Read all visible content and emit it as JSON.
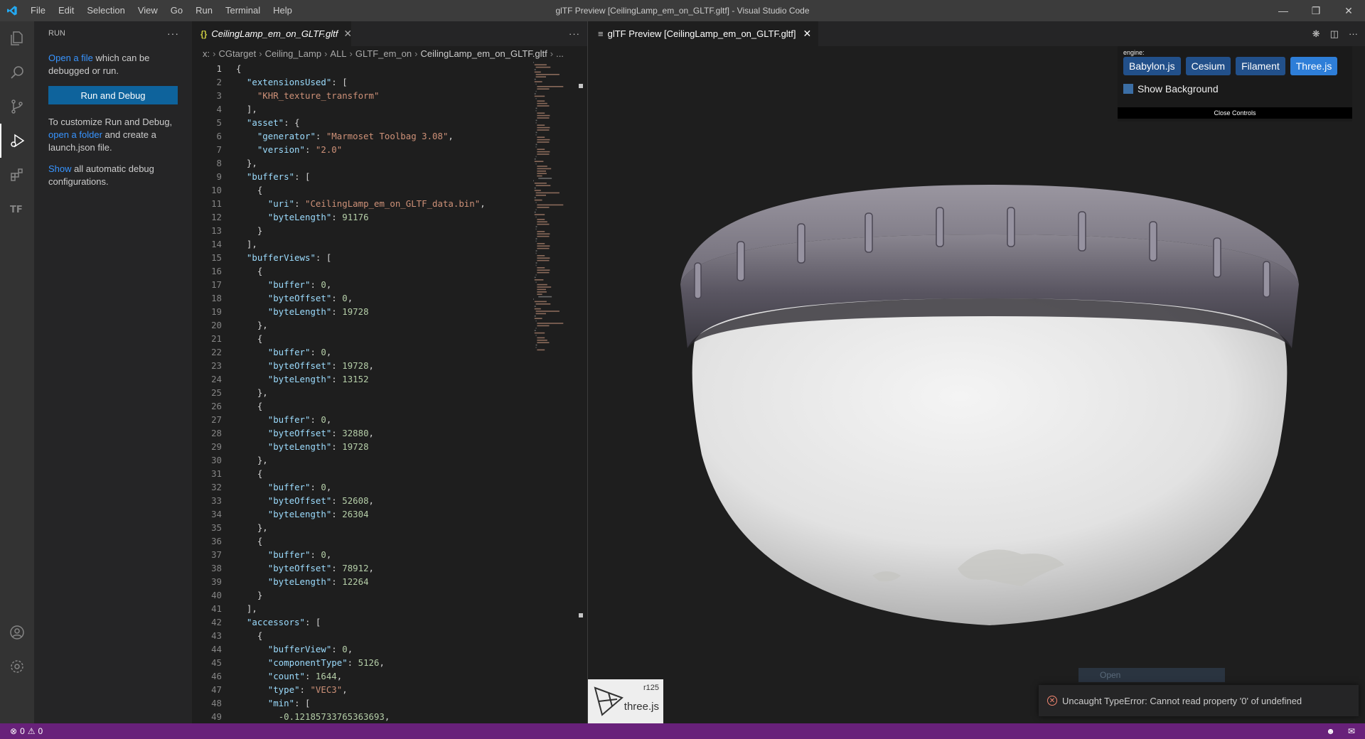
{
  "window": {
    "title": "glTF Preview [CeilingLamp_em_on_GLTF.gltf] - Visual Studio Code",
    "menu": [
      "File",
      "Edit",
      "Selection",
      "View",
      "Go",
      "Run",
      "Terminal",
      "Help"
    ]
  },
  "sidebar": {
    "header": "RUN",
    "open_file_link": "Open a file",
    "open_file_text": " which can be debugged or run.",
    "run_button": "Run and Debug",
    "customize_text1": "To customize Run and Debug, ",
    "open_folder_link": "open a folder",
    "customize_text2": " and create a launch.json file.",
    "show_link": "Show",
    "show_text": " all automatic debug configurations."
  },
  "editor": {
    "tab_label": "CeilingLamp_em_on_GLTF.gltf",
    "breadcrumb": [
      "x:",
      "CGtarget",
      "Ceiling_Lamp",
      "ALL",
      "GLTF_em_on",
      "CeilingLamp_em_on_GLTF.gltf",
      "..."
    ],
    "lines": [
      "{",
      "  \"extensionsUsed\": [",
      "    \"KHR_texture_transform\"",
      "  ],",
      "  \"asset\": {",
      "    \"generator\": \"Marmoset Toolbag 3.08\",",
      "    \"version\": \"2.0\"",
      "  },",
      "  \"buffers\": [",
      "    {",
      "      \"uri\": \"CeilingLamp_em_on_GLTF_data.bin\",",
      "      \"byteLength\": 91176",
      "    }",
      "  ],",
      "  \"bufferViews\": [",
      "    {",
      "      \"buffer\": 0,",
      "      \"byteOffset\": 0,",
      "      \"byteLength\": 19728",
      "    },",
      "    {",
      "      \"buffer\": 0,",
      "      \"byteOffset\": 19728,",
      "      \"byteLength\": 13152",
      "    },",
      "    {",
      "      \"buffer\": 0,",
      "      \"byteOffset\": 32880,",
      "      \"byteLength\": 19728",
      "    },",
      "    {",
      "      \"buffer\": 0,",
      "      \"byteOffset\": 52608,",
      "      \"byteLength\": 26304",
      "    },",
      "    {",
      "      \"buffer\": 0,",
      "      \"byteOffset\": 78912,",
      "      \"byteLength\": 12264",
      "    }",
      "  ],",
      "  \"accessors\": [",
      "    {",
      "      \"bufferView\": 0,",
      "      \"componentType\": 5126,",
      "      \"count\": 1644,",
      "      \"type\": \"VEC3\",",
      "      \"min\": [",
      "        -0.12185733765363693,"
    ]
  },
  "preview": {
    "tab_label": "glTF Preview [CeilingLamp_em_on_GLTF.gltf]",
    "engine_label": "engine:",
    "engines": [
      "Babylon.js",
      "Cesium",
      "Filament",
      "Three.js"
    ],
    "selected_engine": "Three.js",
    "show_background": "Show Background",
    "close_controls": "Close Controls",
    "three_revision": "r125",
    "three_name": "three.js",
    "ghost_text": "Open",
    "error_message": "Uncaught TypeError: Cannot read property '0' of undefined"
  },
  "status": {
    "errors": "0",
    "warnings": "0"
  },
  "colors": {
    "status_bar": "#68217a",
    "accent_button": "#0e639c",
    "engine_button": "#22508a"
  }
}
